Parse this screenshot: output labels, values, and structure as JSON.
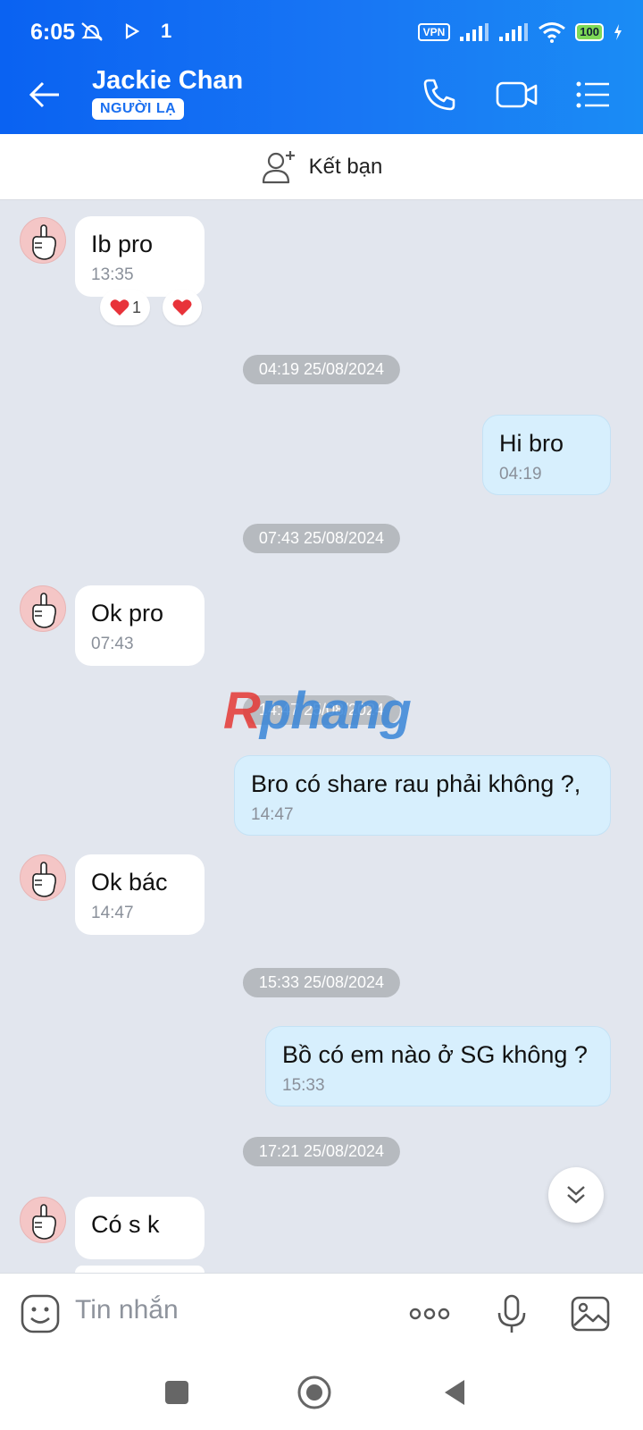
{
  "status": {
    "time": "6:05",
    "extra": "1",
    "vpn": "VPN",
    "battery": "100"
  },
  "header": {
    "title": "Jackie Chan",
    "badge": "NGƯỜI LẠ"
  },
  "add_friend": {
    "label": "Kết bạn"
  },
  "watermark": {
    "first": "R",
    "rest": "phang"
  },
  "messages": [
    {
      "text": "Ib pro",
      "time": "13:35"
    },
    {
      "date": "04:19 25/08/2024"
    },
    {
      "text": "Hi bro",
      "time": "04:19"
    },
    {
      "date": "07:43 25/08/2024"
    },
    {
      "text": "Ok pro",
      "time": "07:43"
    },
    {
      "date": "14:47 25/08/2024"
    },
    {
      "text": "Bro có share rau phải không ?,",
      "time": "14:47"
    },
    {
      "text": "Ok bác",
      "time": "14:47"
    },
    {
      "date": "15:33 25/08/2024"
    },
    {
      "text": "Bồ có em nào ở SG không ?",
      "time": "15:33"
    },
    {
      "date": "17:21 25/08/2024"
    },
    {
      "text": "Có s k"
    }
  ],
  "reactions": {
    "count_label": "1"
  },
  "composer": {
    "placeholder": "Tin nhắn"
  },
  "colors": {
    "header": "#1a72f2",
    "incoming": "#ffffff",
    "outgoing": "#d7effd",
    "chat_bg": "#e2e6ee"
  }
}
